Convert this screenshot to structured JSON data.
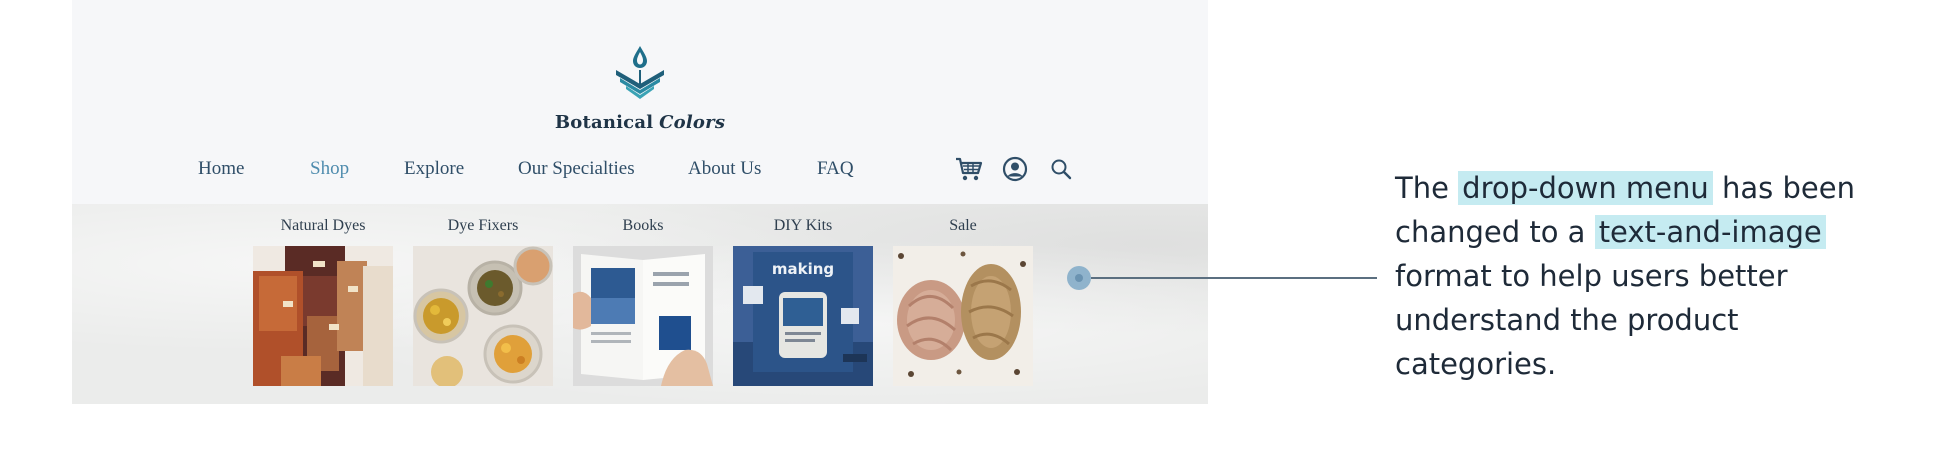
{
  "brand": {
    "name_part1": "Botanical",
    "name_part2": "Colors",
    "logo_icon": "water-drop-leaf-logo"
  },
  "colors": {
    "logo": "#1f6f8b",
    "nav_text": "#2f4e68",
    "nav_active": "#4f8cae",
    "highlight": "#c5ebf1",
    "pointer": "#8fb3cc"
  },
  "nav": {
    "items": [
      {
        "label": "Home"
      },
      {
        "label": "Shop",
        "active": true
      },
      {
        "label": "Explore"
      },
      {
        "label": "Our Specialties"
      },
      {
        "label": "About Us"
      },
      {
        "label": "FAQ"
      }
    ],
    "icons": [
      "cart-icon",
      "account-icon",
      "search-icon"
    ]
  },
  "dropdown": {
    "categories": [
      {
        "label": "Natural Dyes",
        "image": "folded-dyed-fabrics"
      },
      {
        "label": "Dye Fixers",
        "image": "jars-of-dried-flowers"
      },
      {
        "label": "Books",
        "image": "open-book"
      },
      {
        "label": "DIY Kits",
        "image": "indigo-kit-box",
        "image_text": "making"
      },
      {
        "label": "Sale",
        "image": "dyed-yarn-skeins"
      }
    ]
  },
  "annotation": {
    "line1_a": "The",
    "line1_hl": "drop-down menu",
    "line1_b": "has been",
    "line2_a": "changed to a",
    "line2_hl": "text-and-image",
    "line3": "format to help users better",
    "line4": "understand the product",
    "line5": "categories."
  }
}
